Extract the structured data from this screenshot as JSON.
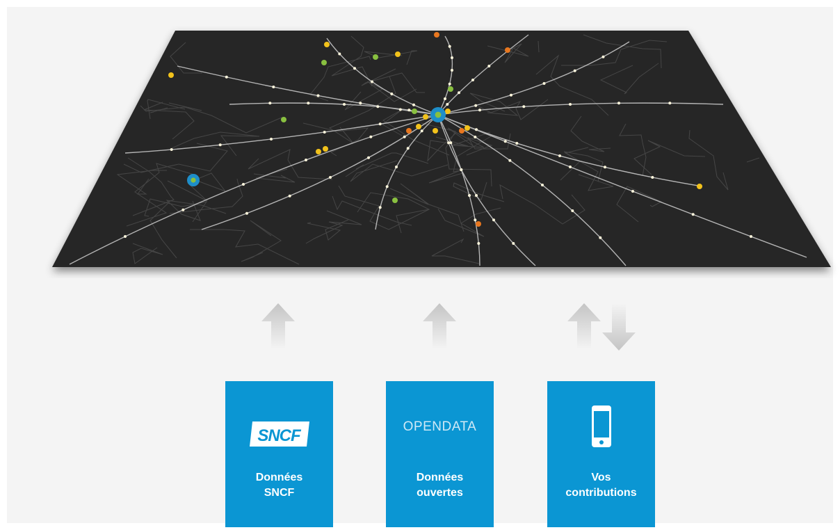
{
  "map": {
    "background_color": "#262626",
    "line_color": "#d9d9d9",
    "station_colors": {
      "station": "#fdf6dc",
      "yellow": "#f2c21b",
      "orange": "#e8771f",
      "green": "#89c040",
      "hub": "#1e8ec9"
    }
  },
  "arrows": [
    {
      "name": "up-arrow-sncf",
      "direction": "up"
    },
    {
      "name": "up-arrow-opendata",
      "direction": "up"
    },
    {
      "name": "up-arrow-contributions",
      "direction": "up"
    },
    {
      "name": "down-arrow-contributions",
      "direction": "down"
    }
  ],
  "cards": [
    {
      "id": "sncf",
      "icon": "sncf-logo",
      "logo_text": "SNCF",
      "label_line1": "Données",
      "label_line2": "SNCF"
    },
    {
      "id": "opendata",
      "icon": "opendata-text",
      "logo_text": "OPENDATA",
      "label_line1": "Données",
      "label_line2": "ouvertes"
    },
    {
      "id": "contributions",
      "icon": "smartphone-icon",
      "label_line1": "Vos",
      "label_line2": "contributions"
    }
  ],
  "colors": {
    "card_background": "#0b96d3",
    "card_text": "#ffffff",
    "arrow": "#c4c4c4",
    "panel": "#f4f4f4"
  }
}
